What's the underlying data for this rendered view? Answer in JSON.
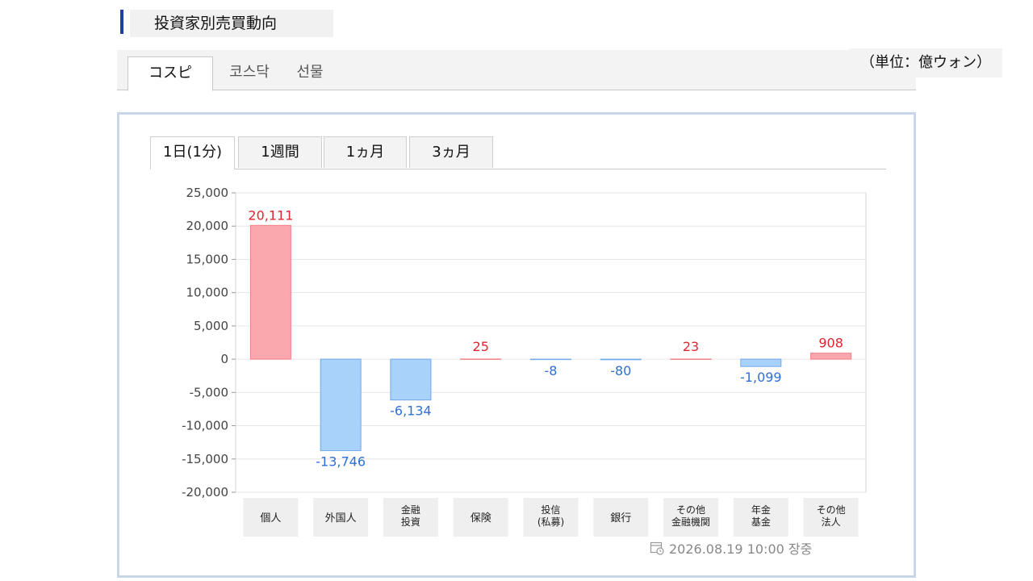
{
  "header": {
    "title": "投資家別売買動向",
    "unit": "（単位：億ウォン）"
  },
  "market_tabs": [
    {
      "label": "コスピ",
      "active": true
    },
    {
      "label": "코스닥",
      "active": false
    },
    {
      "label": "선물",
      "active": false
    }
  ],
  "period_tabs": [
    {
      "label": "1日(1分)",
      "active": true
    },
    {
      "label": "1週間",
      "active": false
    },
    {
      "label": "1ヵ月",
      "active": false
    },
    {
      "label": "3ヵ月",
      "active": false
    }
  ],
  "chart_data": {
    "type": "bar",
    "categories": [
      [
        "個人"
      ],
      [
        "外国人"
      ],
      [
        "金融",
        "投資"
      ],
      [
        "保険"
      ],
      [
        "投信",
        "(私募)"
      ],
      [
        "銀行"
      ],
      [
        "その他",
        "金融機関"
      ],
      [
        "年金",
        "基金"
      ],
      [
        "その他",
        "法人"
      ]
    ],
    "values": [
      20111,
      -13746,
      -6134,
      25,
      -8,
      -80,
      23,
      -1099,
      908
    ],
    "value_labels": [
      "20,111",
      "-13,746",
      "-6,134",
      "25",
      "-8",
      "-80",
      "23",
      "-1,099",
      "908"
    ],
    "yticks": [
      "25,000",
      "20,000",
      "15,000",
      "10,000",
      "5,000",
      "0",
      "-5,000",
      "-10,000",
      "-15,000",
      "-20,000"
    ],
    "ytick_values": [
      25000,
      20000,
      15000,
      10000,
      5000,
      0,
      -5000,
      -10000,
      -15000,
      -20000
    ],
    "ylim": [
      -20000,
      25000
    ],
    "grid": true,
    "colors": {
      "positive_fill": "#f9a8ad",
      "positive_stroke": "#f08088",
      "positive_text": "#e0262f",
      "negative_fill": "#a9d2fb",
      "negative_stroke": "#6fa8e8",
      "negative_text": "#2f6fd6"
    }
  },
  "footer": {
    "timestamp": "2026.08.19 10:00 장중"
  }
}
